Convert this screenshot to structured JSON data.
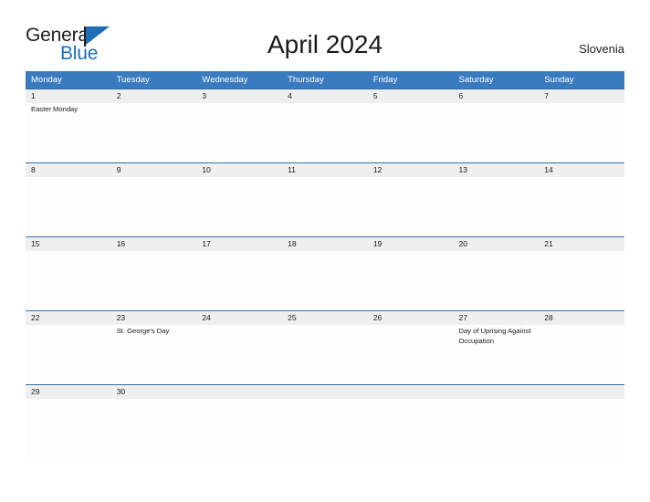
{
  "brand": {
    "name_part1": "General",
    "name_part2": "Blue",
    "flag_icon": "flag-icon",
    "accent_color": "#1d6eb7"
  },
  "header": {
    "title": "April 2024",
    "country": "Slovenia"
  },
  "theme": {
    "header_blue": "#3a7bbf",
    "row_line": "#2f6ea8",
    "daynum_band": "#efefef",
    "text": "#1a1a1a"
  },
  "calendar": {
    "month": "April",
    "year": "2024",
    "weekdays": [
      "Monday",
      "Tuesday",
      "Wednesday",
      "Thursday",
      "Friday",
      "Saturday",
      "Sunday"
    ],
    "weeks": [
      {
        "days": [
          {
            "num": "1",
            "events": [
              "Easter Monday"
            ]
          },
          {
            "num": "2",
            "events": []
          },
          {
            "num": "3",
            "events": []
          },
          {
            "num": "4",
            "events": []
          },
          {
            "num": "5",
            "events": []
          },
          {
            "num": "6",
            "events": []
          },
          {
            "num": "7",
            "events": []
          }
        ]
      },
      {
        "days": [
          {
            "num": "8",
            "events": []
          },
          {
            "num": "9",
            "events": []
          },
          {
            "num": "10",
            "events": []
          },
          {
            "num": "11",
            "events": []
          },
          {
            "num": "12",
            "events": []
          },
          {
            "num": "13",
            "events": []
          },
          {
            "num": "14",
            "events": []
          }
        ]
      },
      {
        "days": [
          {
            "num": "15",
            "events": []
          },
          {
            "num": "16",
            "events": []
          },
          {
            "num": "17",
            "events": []
          },
          {
            "num": "18",
            "events": []
          },
          {
            "num": "19",
            "events": []
          },
          {
            "num": "20",
            "events": []
          },
          {
            "num": "21",
            "events": []
          }
        ]
      },
      {
        "days": [
          {
            "num": "22",
            "events": []
          },
          {
            "num": "23",
            "events": [
              "St. George's Day"
            ]
          },
          {
            "num": "24",
            "events": []
          },
          {
            "num": "25",
            "events": []
          },
          {
            "num": "26",
            "events": []
          },
          {
            "num": "27",
            "events": [
              "Day of Uprising Against Occupation"
            ]
          },
          {
            "num": "28",
            "events": []
          }
        ]
      },
      {
        "days": [
          {
            "num": "29",
            "events": []
          },
          {
            "num": "30",
            "events": []
          },
          {
            "num": "",
            "events": []
          },
          {
            "num": "",
            "events": []
          },
          {
            "num": "",
            "events": []
          },
          {
            "num": "",
            "events": []
          },
          {
            "num": "",
            "events": []
          }
        ]
      }
    ]
  }
}
